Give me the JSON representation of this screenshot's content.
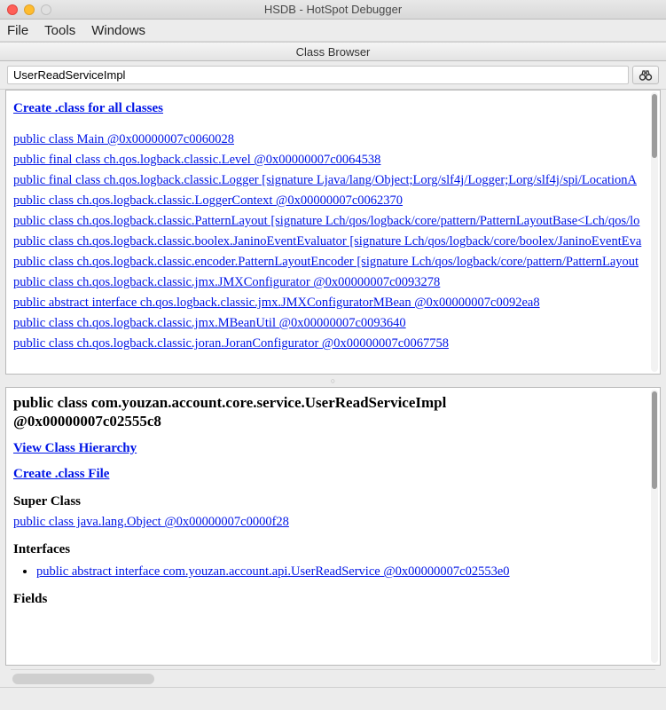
{
  "window": {
    "title": "HSDB - HotSpot Debugger",
    "subtitle": "Class Browser",
    "menus": [
      "File",
      "Tools",
      "Windows"
    ]
  },
  "search": {
    "value": "UserReadServiceImpl",
    "icon_label": "binoculars"
  },
  "top_pane": {
    "action": "Create .class for all classes",
    "classes": [
      "public class Main @0x00000007c0060028",
      "public final class ch.qos.logback.classic.Level @0x00000007c0064538",
      "public final class ch.qos.logback.classic.Logger [signature Ljava/lang/Object;Lorg/slf4j/Logger;Lorg/slf4j/spi/LocationA",
      "public class ch.qos.logback.classic.LoggerContext @0x00000007c0062370",
      "public class ch.qos.logback.classic.PatternLayout [signature Lch/qos/logback/core/pattern/PatternLayoutBase<Lch/qos/lo",
      "public class ch.qos.logback.classic.boolex.JaninoEventEvaluator [signature Lch/qos/logback/core/boolex/JaninoEventEva",
      "public class ch.qos.logback.classic.encoder.PatternLayoutEncoder [signature Lch/qos/logback/core/pattern/PatternLayout",
      "public class ch.qos.logback.classic.jmx.JMXConfigurator @0x00000007c0093278",
      "public abstract interface ch.qos.logback.classic.jmx.JMXConfiguratorMBean @0x00000007c0092ea8",
      "public class ch.qos.logback.classic.jmx.MBeanUtil @0x00000007c0093640",
      "public class ch.qos.logback.classic.joran.JoranConfigurator @0x00000007c0067758"
    ]
  },
  "detail": {
    "heading_line1": "public class com.youzan.account.core.service.UserReadServiceImpl",
    "heading_line2": "@0x00000007c02555c8",
    "links": {
      "view_hierarchy": "View Class Hierarchy",
      "create_class_file": "Create .class File"
    },
    "sections": {
      "super_class_label": "Super Class",
      "super_class_link": "public class java.lang.Object @0x00000007c0000f28",
      "interfaces_label": "Interfaces",
      "interface_link": "public abstract interface com.youzan.account.api.UserReadService @0x00000007c02553e0",
      "fields_label": "Fields"
    }
  }
}
